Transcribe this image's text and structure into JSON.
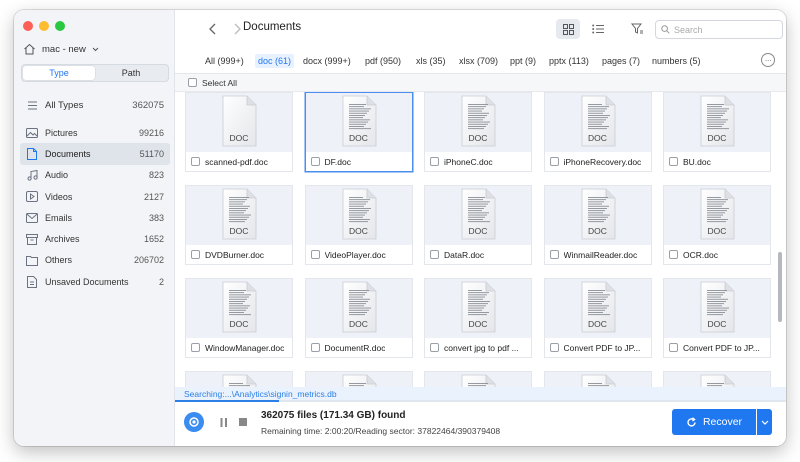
{
  "window": {
    "traffic_lights": {
      "close": "#fe5f57",
      "minimize": "#febc2e",
      "maximize": "#28c840"
    }
  },
  "sidebar": {
    "device": "mac - new",
    "mode_tabs": [
      {
        "label": "Type",
        "active": true
      },
      {
        "label": "Path",
        "active": false
      }
    ],
    "items": [
      {
        "label": "All Types",
        "count": "362075",
        "icon": "list-icon"
      },
      {
        "label": "Pictures",
        "count": "99216",
        "icon": "image-icon"
      },
      {
        "label": "Documents",
        "count": "51170",
        "icon": "document-icon",
        "selected": true
      },
      {
        "label": "Audio",
        "count": "823",
        "icon": "music-icon"
      },
      {
        "label": "Videos",
        "count": "2127",
        "icon": "video-icon"
      },
      {
        "label": "Emails",
        "count": "383",
        "icon": "mail-icon"
      },
      {
        "label": "Archives",
        "count": "1652",
        "icon": "archive-icon"
      },
      {
        "label": "Others",
        "count": "206702",
        "icon": "others-icon"
      },
      {
        "label": "Unsaved Documents",
        "count": "2",
        "icon": "unsaved-doc-icon"
      }
    ]
  },
  "toolbar": {
    "title": "Documents",
    "search_placeholder": "Search"
  },
  "filter_tabs": [
    {
      "label": "All (999+)",
      "active": false
    },
    {
      "label": "doc (61)",
      "active": true
    },
    {
      "label": "docx (999+)",
      "active": false
    },
    {
      "label": "pdf (950)",
      "active": false
    },
    {
      "label": "xls (35)",
      "active": false
    },
    {
      "label": "xlsx (709)",
      "active": false
    },
    {
      "label": "ppt (9)",
      "active": false
    },
    {
      "label": "pptx (113)",
      "active": false
    },
    {
      "label": "pages (7)",
      "active": false
    },
    {
      "label": "numbers (5)",
      "active": false
    }
  ],
  "select_all_label": "Select All",
  "files": [
    {
      "name": "scanned-pdf.doc",
      "type": "DOC",
      "lines": false,
      "selected": false
    },
    {
      "name": "DF.doc",
      "type": "DOC",
      "lines": true,
      "selected": true
    },
    {
      "name": "iPhoneC.doc",
      "type": "DOC",
      "lines": true,
      "selected": false
    },
    {
      "name": "iPhoneRecovery.doc",
      "type": "DOC",
      "lines": true,
      "selected": false
    },
    {
      "name": "BU.doc",
      "type": "DOC",
      "lines": true,
      "selected": false
    },
    {
      "name": "DVDBurner.doc",
      "type": "DOC",
      "lines": true,
      "selected": false
    },
    {
      "name": "VideoPlayer.doc",
      "type": "DOC",
      "lines": true,
      "selected": false
    },
    {
      "name": "DataR.doc",
      "type": "DOC",
      "lines": true,
      "selected": false
    },
    {
      "name": "WinmailReader.doc",
      "type": "DOC",
      "lines": true,
      "selected": false
    },
    {
      "name": "OCR.doc",
      "type": "DOC",
      "lines": true,
      "selected": false
    },
    {
      "name": "WindowManager.doc",
      "type": "DOC",
      "lines": true,
      "selected": false
    },
    {
      "name": "DocumentR.doc",
      "type": "DOC",
      "lines": true,
      "selected": false
    },
    {
      "name": "convert jpg to pdf ...",
      "type": "DOC",
      "lines": true,
      "selected": false
    },
    {
      "name": "Convert  PDF to JP...",
      "type": "DOC",
      "lines": true,
      "selected": false
    },
    {
      "name": "Convert  PDF to JP...",
      "type": "DOC",
      "lines": true,
      "selected": false
    }
  ],
  "status": {
    "searching": "Searching:...\\Analytics\\signin_metrics.db",
    "progress_percent": 17,
    "found": "362075 files (171.34 GB) found",
    "remaining": "Remaining time: 2:00:20/Reading sector: 37822464/390379408",
    "recover_label": "Recover"
  },
  "colors": {
    "accent": "#1f78f0",
    "sidebar_bg": "#f2f4f7",
    "thumb_bg": "#eef2f8"
  }
}
